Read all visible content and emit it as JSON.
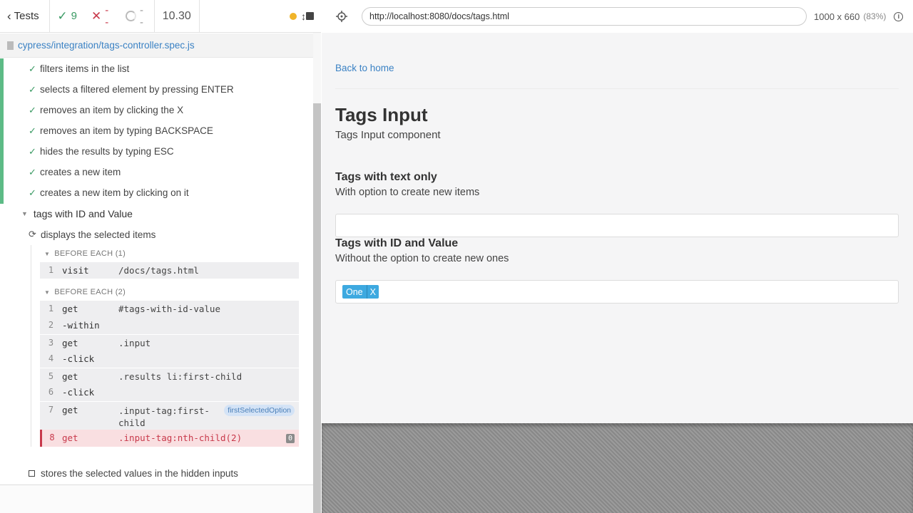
{
  "reporter": {
    "tests_label": "Tests",
    "stats": {
      "passed": "9",
      "failed": "--",
      "pending": "--"
    },
    "duration": "10.30",
    "spec_file": "cypress/integration/tags-controller.spec.js",
    "passed_tests": [
      "filters items in the list",
      "selects a filtered element by pressing ENTER",
      "removes an item by clicking the X",
      "removes an item by typing BACKSPACE",
      "hides the results by typing ESC",
      "creates a new item",
      "creates a new item by clicking on it"
    ],
    "suite_title": "tags with ID and Value",
    "running_test": "displays the selected items",
    "before_each_1": {
      "title": "BEFORE EACH (1)",
      "commands": [
        {
          "n": "1",
          "name": "visit",
          "msg": "/docs/tags.html"
        }
      ]
    },
    "before_each_2": {
      "title": "BEFORE EACH (2)",
      "commands": [
        {
          "n": "1",
          "name": "get",
          "msg": "#tags-with-id-value"
        },
        {
          "n": "2",
          "name": "-within",
          "msg": ""
        },
        {
          "n": "3",
          "name": "get",
          "msg": ".input"
        },
        {
          "n": "4",
          "name": "-click",
          "msg": ""
        },
        {
          "n": "5",
          "name": "get",
          "msg": ".results li:first-child"
        },
        {
          "n": "6",
          "name": "-click",
          "msg": ""
        },
        {
          "n": "7",
          "name": "get",
          "msg": ".input-tag:first-child",
          "alias": "firstSelectedOption"
        },
        {
          "n": "8",
          "name": "get",
          "msg": ".input-tag:nth-child(2)",
          "badge": "0"
        }
      ]
    },
    "pending_test": "stores the selected values in the hidden inputs"
  },
  "aut": {
    "url": "http://localhost:8080/docs/tags.html",
    "viewport": "1000 x 660",
    "scale": "(83%)",
    "page": {
      "back_link": "Back to home",
      "title": "Tags Input",
      "subtitle": "Tags Input component",
      "section1_title": "Tags with text only",
      "section1_desc": "With option to create new items",
      "section2_title": "Tags with ID and Value",
      "section2_desc": "Without the option to create new ones",
      "tag_label": "One",
      "tag_remove": "X"
    }
  },
  "colors": {
    "pass": "#3a9a63",
    "fail": "#c8394b",
    "link": "#3b82c4",
    "tag": "#3da9e0"
  }
}
